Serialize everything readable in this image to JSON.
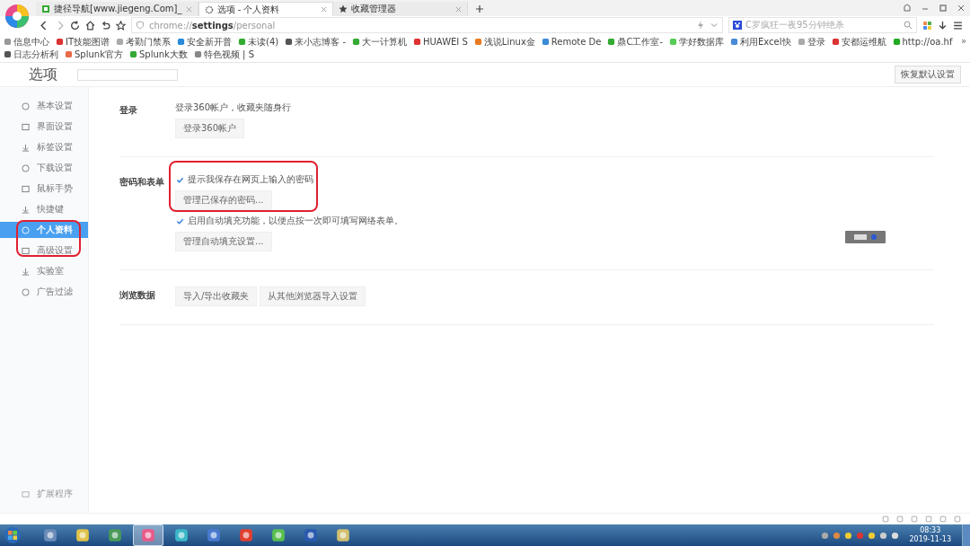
{
  "tabs": [
    {
      "title": "捷径导航[www.jiegeng.Com]_",
      "selected": false
    },
    {
      "title": "选项 - 个人资料",
      "selected": true
    },
    {
      "title": "收藏管理器",
      "selected": false
    }
  ],
  "address": {
    "url": "chrome://**settings**/personal",
    "search": "C罗疯狂一夜95分钟绝杀"
  },
  "bookmarks": [
    "信息中心",
    "IT技能图谱",
    "考勤门禁系",
    "安全新开普",
    "未读(4)",
    "来小志博客 -",
    "大一计算机",
    "HUAWEI S",
    "浅说Linux金",
    "Remote De",
    "鼎C工作室-",
    "学好数据库",
    "利用Excel快",
    "登录",
    "安都运维航",
    "http://oa.hf",
    "日志分析利",
    "Splunk官方",
    "Splunk大数",
    "特色视频 | S"
  ],
  "bookmarks_more": "»",
  "page": {
    "title": "选项",
    "reset_button": "恢复默认设置"
  },
  "sidebar": {
    "items": [
      {
        "label": "基本设置",
        "selected": false
      },
      {
        "label": "界面设置",
        "selected": false
      },
      {
        "label": "标签设置",
        "selected": false
      },
      {
        "label": "下载设置",
        "selected": false
      },
      {
        "label": "鼠标手势",
        "selected": false
      },
      {
        "label": "快捷键",
        "selected": false
      },
      {
        "label": "个人资料",
        "selected": true
      },
      {
        "label": "高级设置",
        "selected": false
      },
      {
        "label": "实验室",
        "selected": false
      },
      {
        "label": "广告过滤",
        "selected": false
      }
    ],
    "footer": "扩展程序"
  },
  "sections": [
    {
      "title": "登录",
      "rows": [
        {
          "kind": "text",
          "label": "登录360帐户，收藏夹随身行"
        },
        {
          "kind": "button",
          "label": "登录360帐户"
        }
      ]
    },
    {
      "title": "密码和表单",
      "rows": [
        {
          "kind": "checkbox",
          "label": "提示我保存在网页上输入的密码",
          "checked": true
        },
        {
          "kind": "button",
          "label": "管理已保存的密码..."
        },
        {
          "kind": "checkbox",
          "label": "启用自动填充功能，以便点按一次即可填写网络表单。",
          "checked": true
        },
        {
          "kind": "button",
          "label": "管理自动填充设置..."
        }
      ]
    },
    {
      "title": "浏览数据",
      "rows": [
        {
          "kind": "buttons",
          "labels": [
            "导入/导出收藏夹",
            "从其他浏览器导入设置"
          ]
        }
      ]
    }
  ],
  "taskbar": {
    "apps": [
      {
        "selected": false
      },
      {
        "selected": false
      },
      {
        "selected": false
      },
      {
        "selected": true
      },
      {
        "selected": false
      },
      {
        "selected": false
      },
      {
        "selected": false
      },
      {
        "selected": false
      },
      {
        "selected": false
      },
      {
        "selected": false
      }
    ],
    "time": "08:33",
    "date": "2019-11-13"
  }
}
